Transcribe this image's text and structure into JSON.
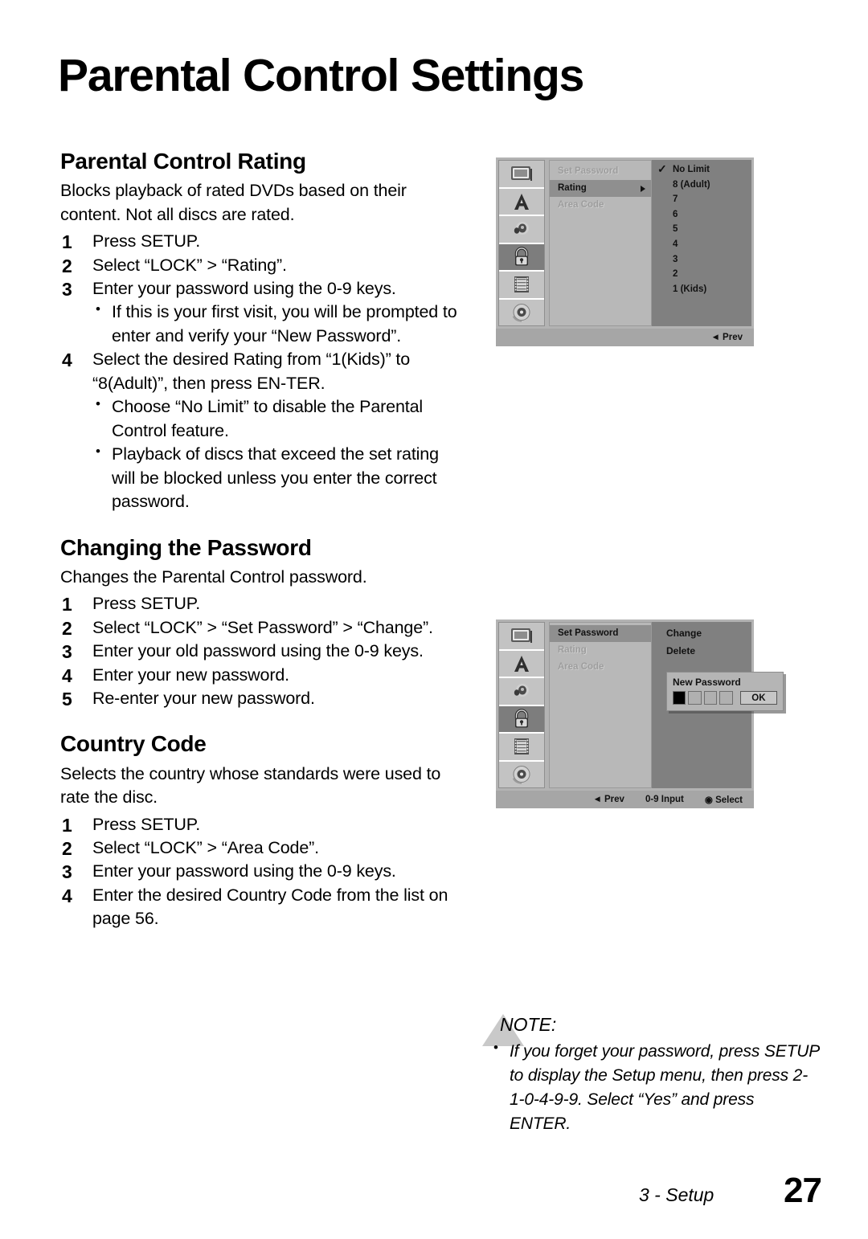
{
  "page": {
    "title": "Parental Control Settings",
    "section_footer": "3 - Setup",
    "page_number": "27"
  },
  "sections": [
    {
      "heading": "Parental Control Rating",
      "intro": "Blocks playback of rated DVDs based on their content. Not all discs are rated.",
      "steps": [
        {
          "num": "1",
          "text": "Press SETUP."
        },
        {
          "num": "2",
          "text": "Select “LOCK” > “Rating”."
        },
        {
          "num": "3",
          "text": "Enter your password using the 0-9 keys."
        }
      ],
      "bullets_after_3": [
        "If this is your first visit, you will be prompted to enter and verify your “New Password”."
      ],
      "step4": {
        "num": "4",
        "text": "Select the desired Rating from “1(Kids)” to “8(Adult)”, then press EN-TER."
      },
      "bullets_after_4": [
        "Choose “No Limit” to disable the Parental Control feature.",
        "Playback of discs that exceed the set rating will be blocked unless you enter the correct password."
      ]
    },
    {
      "heading": "Changing the Password",
      "intro": "Changes the Parental Control password.",
      "steps": [
        {
          "num": "1",
          "text": "Press SETUP."
        },
        {
          "num": "2",
          "text": "Select “LOCK” > “Set Password” > “Change”."
        },
        {
          "num": "3",
          "text": "Enter your old password using the 0-9 keys."
        },
        {
          "num": "4",
          "text": "Enter your new password."
        },
        {
          "num": "5",
          "text": "Re-enter your new password."
        }
      ]
    },
    {
      "heading": "Country Code",
      "intro": "Selects the country whose standards were used to rate the disc.",
      "steps": [
        {
          "num": "1",
          "text": "Press SETUP."
        },
        {
          "num": "2",
          "text": "Select “LOCK” > “Area Code”."
        },
        {
          "num": "3",
          "text": "Enter your password using the 0-9 keys."
        },
        {
          "num": "4",
          "text": "Enter the desired Country Code from the list on page 56."
        }
      ]
    }
  ],
  "osd_rating": {
    "sidebar_icons": [
      "display-icon",
      "language-icon",
      "audio-icon",
      "lock-icon",
      "film-icon",
      "disc-icon"
    ],
    "active_icon_index": 3,
    "menu_items": [
      {
        "label": "Set Password",
        "selected": false,
        "arrow": false
      },
      {
        "label": "Rating",
        "selected": true,
        "arrow": true
      },
      {
        "label": "Area Code",
        "selected": false,
        "arrow": false
      }
    ],
    "rating_options": [
      {
        "label": "No Limit",
        "checked": true
      },
      {
        "label": "8 (Adult)",
        "checked": false
      },
      {
        "label": "7",
        "checked": false
      },
      {
        "label": "6",
        "checked": false
      },
      {
        "label": "5",
        "checked": false
      },
      {
        "label": "4",
        "checked": false
      },
      {
        "label": "3",
        "checked": false
      },
      {
        "label": "2",
        "checked": false
      },
      {
        "label": "1 (Kids)",
        "checked": false
      }
    ],
    "footer": [
      "◄ Prev"
    ]
  },
  "osd_password": {
    "sidebar_icons": [
      "display-icon",
      "language-icon",
      "audio-icon",
      "lock-icon",
      "film-icon",
      "disc-icon"
    ],
    "active_icon_index": 3,
    "menu_items": [
      {
        "label": "Set Password",
        "selected": true,
        "arrow": false
      },
      {
        "label": "Rating",
        "selected": false,
        "arrow": false
      },
      {
        "label": "Area Code",
        "selected": false,
        "arrow": false
      }
    ],
    "right_items": [
      "Change",
      "Delete"
    ],
    "dialog": {
      "title": "New Password",
      "boxes": [
        true,
        false,
        false,
        false
      ],
      "ok_label": "OK"
    },
    "footer": [
      "◄ Prev",
      "0-9 Input",
      "◉ Select"
    ]
  },
  "note": {
    "label": "NOTE:",
    "items": [
      "If you forget your password, press SETUP to display the Setup menu, then press 2-1-0-4-9-9. Select “Yes” and press ENTER."
    ]
  },
  "colors": {
    "osd_bg": "#b3b3b3",
    "osd_right_bg": "#808080",
    "osd_selected": "#8f8f8f",
    "osd_footer": "#a6a6a6",
    "note_triangle": "#c9c9c9"
  }
}
